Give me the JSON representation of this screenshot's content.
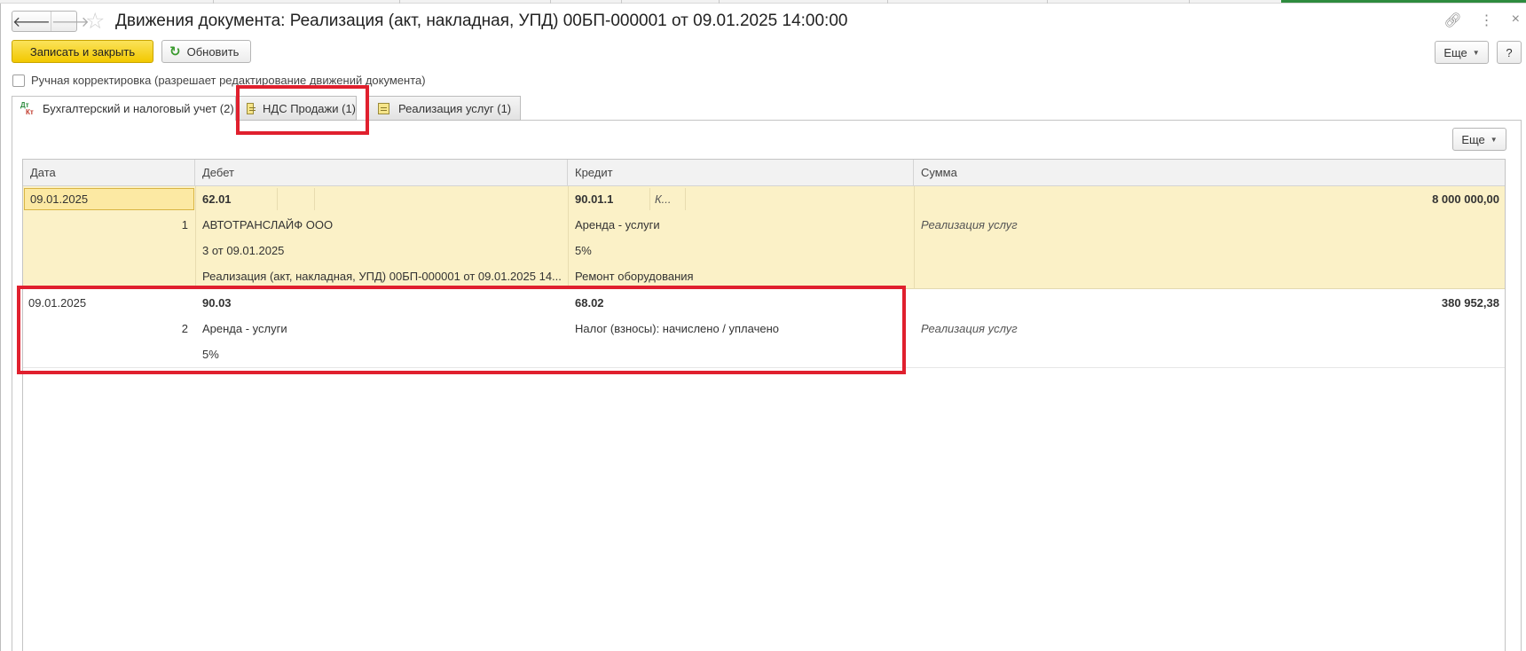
{
  "window": {
    "title": "Движения документа: Реализация (акт, накладная, УПД) 00БП-000001 от 09.01.2025 14:00:00",
    "nav_back_icon": "arrow-left-icon",
    "nav_forward_icon": "arrow-right-icon",
    "favorite_icon": "star-icon",
    "link_icon": "link-icon",
    "menu_icon": "kebab-menu-icon",
    "close_icon": "close-icon"
  },
  "toolbar": {
    "save_close_label": "Записать и закрыть",
    "refresh_label": "Обновить",
    "more_label": "Еще",
    "help_label": "?"
  },
  "manual_correction": {
    "label": "Ручная корректировка (разрешает редактирование движений документа)",
    "checked": false
  },
  "tabs": [
    {
      "label": "Бухгалтерский и налоговый учет (2)",
      "active": true,
      "icon": "dt-kt-icon"
    },
    {
      "label": "НДС Продажи (1)",
      "active": false,
      "icon": "register-icon"
    },
    {
      "label": "Реализация услуг (1)",
      "active": false,
      "icon": "register-icon"
    }
  ],
  "panel": {
    "more_label": "Еще"
  },
  "table": {
    "columns": [
      "Дата",
      "Дебет",
      "Кредит",
      "Сумма"
    ],
    "rows": [
      {
        "date": "09.01.2025",
        "number": "1",
        "debit_account": "62.01",
        "debit_sub1": "АВТОТРАНСЛАЙФ ООО",
        "debit_sub2": "3 от 09.01.2025",
        "debit_sub3": "Реализация (акт, накладная, УПД) 00БП-000001 от 09.01.2025 14...",
        "credit_account": "90.01.1",
        "credit_extra": "К...",
        "credit_sub1": "Аренда - услуги",
        "credit_sub2": "5%",
        "credit_sub3": "Ремонт оборудования",
        "amount": "8 000 000,00",
        "content": "Реализация услуг"
      },
      {
        "date": "09.01.2025",
        "number": "2",
        "debit_account": "90.03",
        "debit_sub1": "Аренда - услуги",
        "debit_sub2": "5%",
        "credit_account": "68.02",
        "credit_sub1": "Налог (взносы): начислено / уплачено",
        "amount": "380 952,38",
        "content": "Реализация услуг"
      }
    ]
  },
  "colors": {
    "primary_button": "#f2c800",
    "selected_row": "#fbf1c7",
    "annotation_red": "#e0202e"
  }
}
